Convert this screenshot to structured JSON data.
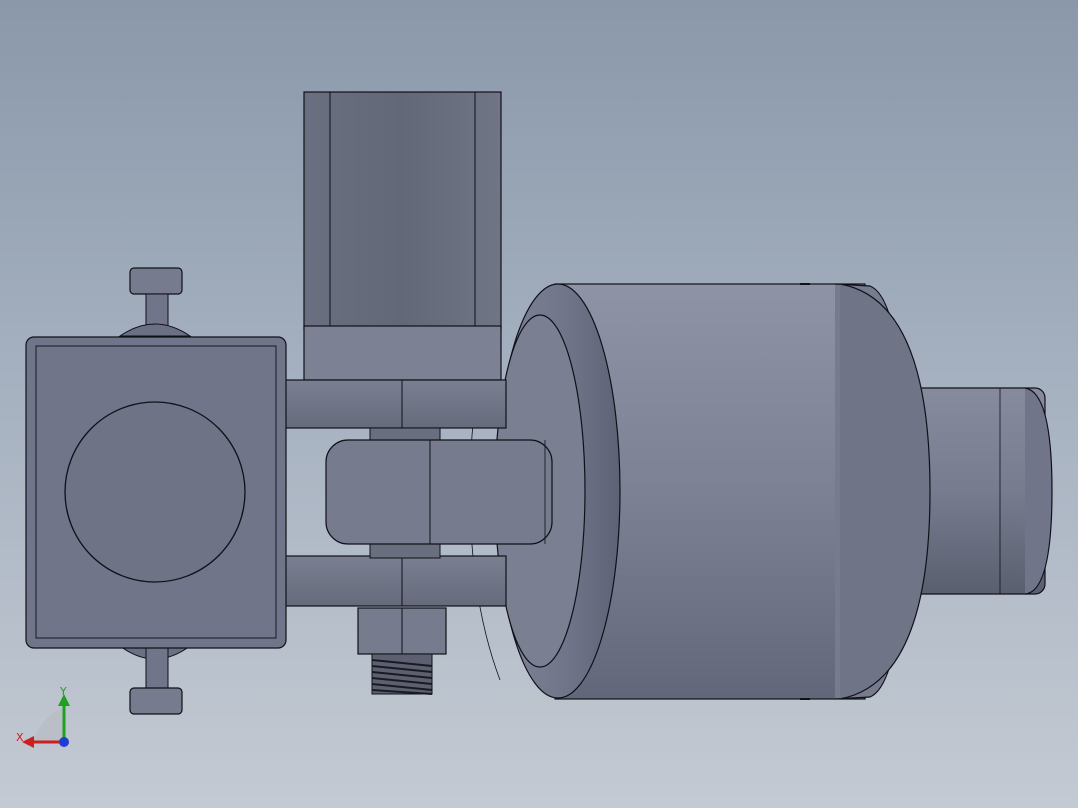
{
  "viewport": {
    "background_top": "#8a98aa",
    "background_bottom": "#c4cad3"
  },
  "model": {
    "body_color": "#6e7384",
    "edge_color": "#101018"
  },
  "triad": {
    "x_label": "X",
    "y_label": "Y",
    "x_color": "#cc1f1f",
    "y_color": "#1fa01f",
    "z_color": "#1f3fd0"
  }
}
